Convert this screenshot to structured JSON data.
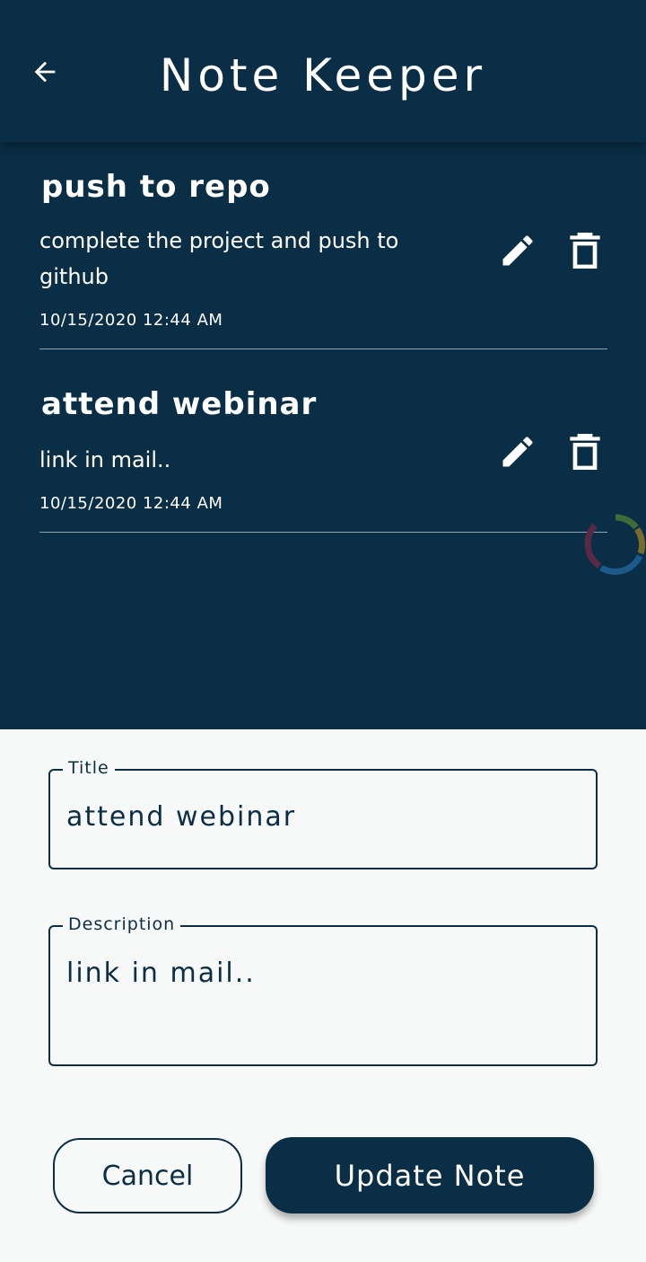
{
  "app_bar": {
    "title": "Note Keeper",
    "back_icon": "arrow-left-icon"
  },
  "notes": [
    {
      "title": "push to repo",
      "description": "complete the project and push to github",
      "timestamp": "10/15/2020 12:44 AM"
    },
    {
      "title": "attend webinar",
      "description": "link in mail..",
      "timestamp": "10/15/2020 12:44 AM"
    }
  ],
  "form": {
    "title_label": "Title",
    "title_value": "attend webinar",
    "description_label": "Description",
    "description_value": "link in mail..",
    "cancel_label": "Cancel",
    "update_label": "Update Note"
  },
  "colors": {
    "primary": "#0a2e45",
    "sheet_background": "#f7f8f8",
    "on_primary": "#ffffff"
  }
}
